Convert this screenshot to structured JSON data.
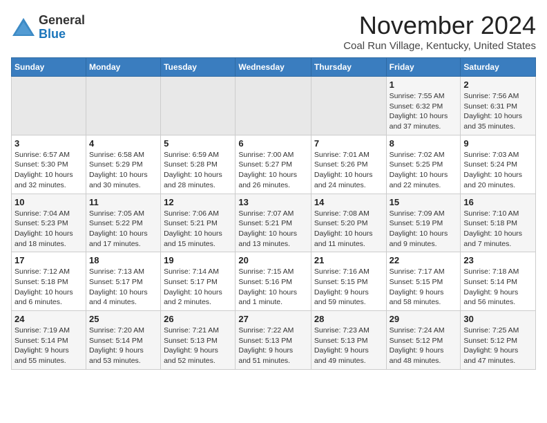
{
  "header": {
    "logo_line1": "General",
    "logo_line2": "Blue",
    "month_title": "November 2024",
    "subtitle": "Coal Run Village, Kentucky, United States"
  },
  "weekdays": [
    "Sunday",
    "Monday",
    "Tuesday",
    "Wednesday",
    "Thursday",
    "Friday",
    "Saturday"
  ],
  "weeks": [
    [
      {
        "day": "",
        "info": ""
      },
      {
        "day": "",
        "info": ""
      },
      {
        "day": "",
        "info": ""
      },
      {
        "day": "",
        "info": ""
      },
      {
        "day": "",
        "info": ""
      },
      {
        "day": "1",
        "info": "Sunrise: 7:55 AM\nSunset: 6:32 PM\nDaylight: 10 hours\nand 37 minutes."
      },
      {
        "day": "2",
        "info": "Sunrise: 7:56 AM\nSunset: 6:31 PM\nDaylight: 10 hours\nand 35 minutes."
      }
    ],
    [
      {
        "day": "3",
        "info": "Sunrise: 6:57 AM\nSunset: 5:30 PM\nDaylight: 10 hours\nand 32 minutes."
      },
      {
        "day": "4",
        "info": "Sunrise: 6:58 AM\nSunset: 5:29 PM\nDaylight: 10 hours\nand 30 minutes."
      },
      {
        "day": "5",
        "info": "Sunrise: 6:59 AM\nSunset: 5:28 PM\nDaylight: 10 hours\nand 28 minutes."
      },
      {
        "day": "6",
        "info": "Sunrise: 7:00 AM\nSunset: 5:27 PM\nDaylight: 10 hours\nand 26 minutes."
      },
      {
        "day": "7",
        "info": "Sunrise: 7:01 AM\nSunset: 5:26 PM\nDaylight: 10 hours\nand 24 minutes."
      },
      {
        "day": "8",
        "info": "Sunrise: 7:02 AM\nSunset: 5:25 PM\nDaylight: 10 hours\nand 22 minutes."
      },
      {
        "day": "9",
        "info": "Sunrise: 7:03 AM\nSunset: 5:24 PM\nDaylight: 10 hours\nand 20 minutes."
      }
    ],
    [
      {
        "day": "10",
        "info": "Sunrise: 7:04 AM\nSunset: 5:23 PM\nDaylight: 10 hours\nand 18 minutes."
      },
      {
        "day": "11",
        "info": "Sunrise: 7:05 AM\nSunset: 5:22 PM\nDaylight: 10 hours\nand 17 minutes."
      },
      {
        "day": "12",
        "info": "Sunrise: 7:06 AM\nSunset: 5:21 PM\nDaylight: 10 hours\nand 15 minutes."
      },
      {
        "day": "13",
        "info": "Sunrise: 7:07 AM\nSunset: 5:21 PM\nDaylight: 10 hours\nand 13 minutes."
      },
      {
        "day": "14",
        "info": "Sunrise: 7:08 AM\nSunset: 5:20 PM\nDaylight: 10 hours\nand 11 minutes."
      },
      {
        "day": "15",
        "info": "Sunrise: 7:09 AM\nSunset: 5:19 PM\nDaylight: 10 hours\nand 9 minutes."
      },
      {
        "day": "16",
        "info": "Sunrise: 7:10 AM\nSunset: 5:18 PM\nDaylight: 10 hours\nand 7 minutes."
      }
    ],
    [
      {
        "day": "17",
        "info": "Sunrise: 7:12 AM\nSunset: 5:18 PM\nDaylight: 10 hours\nand 6 minutes."
      },
      {
        "day": "18",
        "info": "Sunrise: 7:13 AM\nSunset: 5:17 PM\nDaylight: 10 hours\nand 4 minutes."
      },
      {
        "day": "19",
        "info": "Sunrise: 7:14 AM\nSunset: 5:17 PM\nDaylight: 10 hours\nand 2 minutes."
      },
      {
        "day": "20",
        "info": "Sunrise: 7:15 AM\nSunset: 5:16 PM\nDaylight: 10 hours\nand 1 minute."
      },
      {
        "day": "21",
        "info": "Sunrise: 7:16 AM\nSunset: 5:15 PM\nDaylight: 9 hours\nand 59 minutes."
      },
      {
        "day": "22",
        "info": "Sunrise: 7:17 AM\nSunset: 5:15 PM\nDaylight: 9 hours\nand 58 minutes."
      },
      {
        "day": "23",
        "info": "Sunrise: 7:18 AM\nSunset: 5:14 PM\nDaylight: 9 hours\nand 56 minutes."
      }
    ],
    [
      {
        "day": "24",
        "info": "Sunrise: 7:19 AM\nSunset: 5:14 PM\nDaylight: 9 hours\nand 55 minutes."
      },
      {
        "day": "25",
        "info": "Sunrise: 7:20 AM\nSunset: 5:14 PM\nDaylight: 9 hours\nand 53 minutes."
      },
      {
        "day": "26",
        "info": "Sunrise: 7:21 AM\nSunset: 5:13 PM\nDaylight: 9 hours\nand 52 minutes."
      },
      {
        "day": "27",
        "info": "Sunrise: 7:22 AM\nSunset: 5:13 PM\nDaylight: 9 hours\nand 51 minutes."
      },
      {
        "day": "28",
        "info": "Sunrise: 7:23 AM\nSunset: 5:13 PM\nDaylight: 9 hours\nand 49 minutes."
      },
      {
        "day": "29",
        "info": "Sunrise: 7:24 AM\nSunset: 5:12 PM\nDaylight: 9 hours\nand 48 minutes."
      },
      {
        "day": "30",
        "info": "Sunrise: 7:25 AM\nSunset: 5:12 PM\nDaylight: 9 hours\nand 47 minutes."
      }
    ]
  ]
}
